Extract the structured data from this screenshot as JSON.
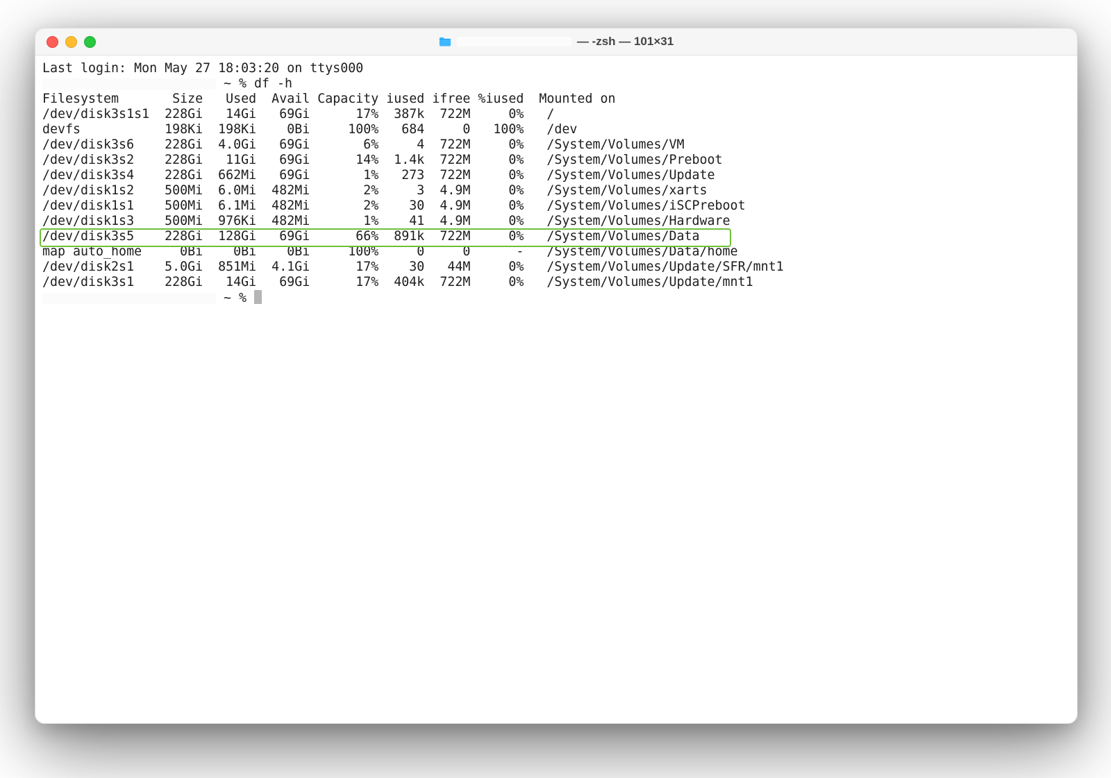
{
  "titlebar": {
    "title_suffix": " — -zsh — 101×31"
  },
  "session": {
    "last_login": "Last login: Mon May 27 18:03:20 on ttys000",
    "prompt_symbol": "~ %",
    "command": "df -h"
  },
  "df": {
    "headers": {
      "filesystem": "Filesystem",
      "size": "Size",
      "used": "Used",
      "avail": "Avail",
      "capacity": "Capacity",
      "iused": "iused",
      "ifree": "ifree",
      "piused": "%iused",
      "mounted": "Mounted on"
    },
    "rows": [
      {
        "filesystem": "/dev/disk3s1s1",
        "size": "228Gi",
        "used": "14Gi",
        "avail": "69Gi",
        "capacity": "17%",
        "iused": "387k",
        "ifree": "722M",
        "piused": "0%",
        "mounted": "/"
      },
      {
        "filesystem": "devfs",
        "size": "198Ki",
        "used": "198Ki",
        "avail": "0Bi",
        "capacity": "100%",
        "iused": "684",
        "ifree": "0",
        "piused": "100%",
        "mounted": "/dev"
      },
      {
        "filesystem": "/dev/disk3s6",
        "size": "228Gi",
        "used": "4.0Gi",
        "avail": "69Gi",
        "capacity": "6%",
        "iused": "4",
        "ifree": "722M",
        "piused": "0%",
        "mounted": "/System/Volumes/VM"
      },
      {
        "filesystem": "/dev/disk3s2",
        "size": "228Gi",
        "used": "11Gi",
        "avail": "69Gi",
        "capacity": "14%",
        "iused": "1.4k",
        "ifree": "722M",
        "piused": "0%",
        "mounted": "/System/Volumes/Preboot"
      },
      {
        "filesystem": "/dev/disk3s4",
        "size": "228Gi",
        "used": "662Mi",
        "avail": "69Gi",
        "capacity": "1%",
        "iused": "273",
        "ifree": "722M",
        "piused": "0%",
        "mounted": "/System/Volumes/Update"
      },
      {
        "filesystem": "/dev/disk1s2",
        "size": "500Mi",
        "used": "6.0Mi",
        "avail": "482Mi",
        "capacity": "2%",
        "iused": "3",
        "ifree": "4.9M",
        "piused": "0%",
        "mounted": "/System/Volumes/xarts"
      },
      {
        "filesystem": "/dev/disk1s1",
        "size": "500Mi",
        "used": "6.1Mi",
        "avail": "482Mi",
        "capacity": "2%",
        "iused": "30",
        "ifree": "4.9M",
        "piused": "0%",
        "mounted": "/System/Volumes/iSCPreboot"
      },
      {
        "filesystem": "/dev/disk1s3",
        "size": "500Mi",
        "used": "976Ki",
        "avail": "482Mi",
        "capacity": "1%",
        "iused": "41",
        "ifree": "4.9M",
        "piused": "0%",
        "mounted": "/System/Volumes/Hardware"
      },
      {
        "filesystem": "/dev/disk3s5",
        "size": "228Gi",
        "used": "128Gi",
        "avail": "69Gi",
        "capacity": "66%",
        "iused": "891k",
        "ifree": "722M",
        "piused": "0%",
        "mounted": "/System/Volumes/Data",
        "highlighted": true
      },
      {
        "filesystem": "map auto_home",
        "size": "0Bi",
        "used": "0Bi",
        "avail": "0Bi",
        "capacity": "100%",
        "iused": "0",
        "ifree": "0",
        "piused": "-",
        "mounted": "/System/Volumes/Data/home"
      },
      {
        "filesystem": "/dev/disk2s1",
        "size": "5.0Gi",
        "used": "851Mi",
        "avail": "4.1Gi",
        "capacity": "17%",
        "iused": "30",
        "ifree": "44M",
        "piused": "0%",
        "mounted": "/System/Volumes/Update/SFR/mnt1"
      },
      {
        "filesystem": "/dev/disk3s1",
        "size": "228Gi",
        "used": "14Gi",
        "avail": "69Gi",
        "capacity": "17%",
        "iused": "404k",
        "ifree": "722M",
        "piused": "0%",
        "mounted": "/System/Volumes/Update/mnt1"
      }
    ]
  },
  "columns": {
    "filesystem_w": 14,
    "size_w": 7,
    "used_w": 7,
    "avail_w": 7,
    "capacity_w": 9,
    "iused_w": 6,
    "ifree_w": 6,
    "piused_w": 7
  }
}
